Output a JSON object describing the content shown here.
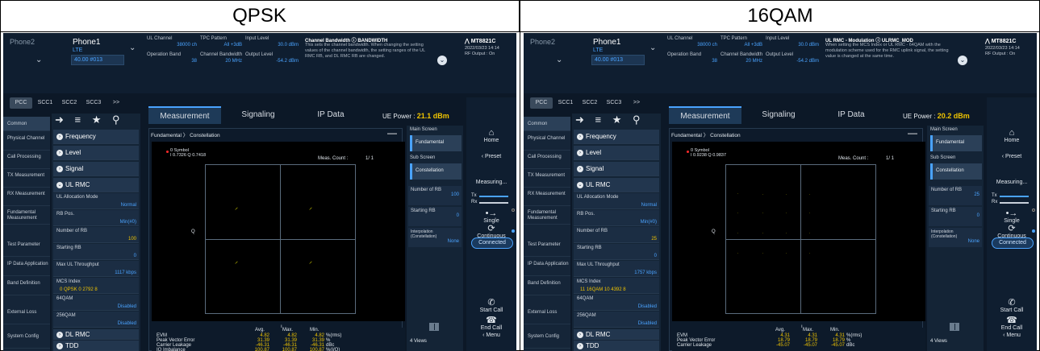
{
  "headers": {
    "left": "QPSK",
    "right": "16QAM"
  },
  "screens": [
    {
      "phone2": "Phone2",
      "phone1": "Phone1",
      "phone1_sub": "LTE",
      "phone1_box": "40.00 #013",
      "ul_channel_label": "UL Channel",
      "ul_channel_value": "38000 ch",
      "tpc_label": "TPC Pattern",
      "tpc_value": "All +3dB",
      "input_level_label": "Input Level",
      "input_level_value": "30.0 dBm",
      "op_band_label": "Operation Band",
      "op_band_value": "38",
      "ch_bw_label": "Channel Bandwidth",
      "ch_bw_value": "20 MHz",
      "output_level_label": "Output Level",
      "output_level_value": "-54.2 dBm",
      "info_title": "Channel Bandwidth ⓘ BANDWIDTH",
      "info_desc": "This sets the channel bandwidth. When changing the setting values of the channel bandwidth, the setting ranges of the UL RMC RB, and DL RMC RB are changed.",
      "model": "MT8821C",
      "datetime": "2022/03/23 14:14",
      "rf_output": "RF Output : On",
      "cc_tabs": [
        "PCC",
        "SCC1",
        "SCC2",
        "SCC3",
        ">>"
      ],
      "sidebar": [
        "Common",
        "Physical Channel",
        "Call Processing",
        "TX Measurement",
        "RX Measurement",
        "Fundamental Measurement",
        "Test Parameter",
        "IP Data Application",
        "Band Definition",
        "External Loss",
        "System Config"
      ],
      "params": {
        "frequency": "Frequency",
        "level": "Level",
        "signal": "Signal",
        "ulrmc": "UL RMC",
        "alloc_label": "UL Allocation Mode",
        "alloc_value": "Normal",
        "rbpos_label": "RB Pos.",
        "rbpos_value": "Min(#0)",
        "nrb_label": "Number of RB",
        "nrb_value": "100",
        "srb_label": "Starting RB",
        "srb_value": "0",
        "tput_label": "Max UL Throughput",
        "tput_value": "1117 kbps",
        "mcs_label": "MCS Index",
        "mcs_value": "0  QPSK  0  2792  8",
        "q64_label": "64QAM",
        "q64_value": "Disabled",
        "q256_label": "256QAM",
        "q256_value": "Disabled",
        "dlrmc": "DL RMC",
        "tdd": "TDD"
      },
      "main_tabs": [
        "Measurement",
        "Signaling",
        "IP Data"
      ],
      "ue_power_label": "UE Power :",
      "ue_power_value": "21.1 dBm",
      "breadcrumb": [
        "Fundamental",
        "Constellation"
      ],
      "symbol_line1": "0 Symbol",
      "symbol_line2": "I 0.7326 Q 0.7418",
      "meas_count_label": "Meas. Count :",
      "meas_count_value": "1/    1",
      "q_axis": "Q",
      "i_axis": "I",
      "result_headers": [
        "Avg.",
        "Max.",
        "Min."
      ],
      "results": [
        {
          "name": "EVM",
          "avg": "4.82",
          "max": "4.82",
          "min": "4.82",
          "unit": "%(rms)"
        },
        {
          "name": "Peak Vector Error",
          "avg": "31.39",
          "max": "31.39",
          "min": "31.39",
          "unit": "%"
        },
        {
          "name": "Carrier Leakage",
          "avg": "-46.31",
          "max": "-46.31",
          "min": "-46.31",
          "unit": "dBc"
        },
        {
          "name": "IQ Imbalance",
          "avg": "100.87",
          "max": "100.87",
          "min": "100.87",
          "unit": "%(I/Q)"
        }
      ],
      "main_screen_label": "Main Screen",
      "main_screen_value": "Fundamental",
      "sub_screen_label": "Sub Screen",
      "sub_screen_value": "Constellation",
      "panel_nrb_label": "Number of RB",
      "panel_nrb_value": "100",
      "panel_srb_label": "Starting RB",
      "panel_srb_value": "0",
      "interp_label": "Interpolation (Constellation)",
      "interp_value": "None",
      "views": "4 Views",
      "controls": {
        "home": "Home",
        "preset": "Preset",
        "measuring": "Measuring...",
        "tx": "Tx",
        "rx": "Rx",
        "single": "Single",
        "continuous": "Continuous",
        "connected": "Connected",
        "start_call": "Start Call",
        "end_call": "End Call",
        "menu": "Menu"
      }
    },
    {
      "phone2": "Phone2",
      "phone1": "Phone1",
      "phone1_sub": "LTE",
      "phone1_box": "40.00 #013",
      "ul_channel_label": "UL Channel",
      "ul_channel_value": "38000 ch",
      "tpc_label": "TPC Pattern",
      "tpc_value": "All +3dB",
      "input_level_label": "Input Level",
      "input_level_value": "30.0 dBm",
      "op_band_label": "Operation Band",
      "op_band_value": "38",
      "ch_bw_label": "Channel Bandwidth",
      "ch_bw_value": "20 MHz",
      "output_level_label": "Output Level",
      "output_level_value": "-54.2 dBm",
      "info_title": "UL RMC - Modulation ⓘ ULRMC_MOD",
      "info_desc": "When setting the MCS Index or UL RMC - 64QAM with the modulation scheme used for the RMC uplink signal, the setting value is changed at the same time.",
      "model": "MT8821C",
      "datetime": "2022/03/23 14:14",
      "rf_output": "RF Output : On",
      "cc_tabs": [
        "PCC",
        "SCC1",
        "SCC2",
        "SCC3",
        ">>"
      ],
      "sidebar": [
        "Common",
        "Physical Channel",
        "Call Processing",
        "TX Measurement",
        "RX Measurement",
        "Fundamental Measurement",
        "Test Parameter",
        "IP Data Application",
        "Band Definition",
        "External Loss",
        "System Config"
      ],
      "params": {
        "frequency": "Frequency",
        "level": "Level",
        "signal": "Signal",
        "ulrmc": "UL RMC",
        "alloc_label": "UL Allocation Mode",
        "alloc_value": "Normal",
        "rbpos_label": "RB Pos.",
        "rbpos_value": "Min(#0)",
        "nrb_label": "Number of RB",
        "nrb_value": "25",
        "srb_label": "Starting RB",
        "srb_value": "0",
        "tput_label": "Max UL Throughput",
        "tput_value": "1757 kbps",
        "mcs_label": "MCS Index",
        "mcs_value": "11  16QAM  10  4392  8",
        "q64_label": "64QAM",
        "q64_value": "Disabled",
        "q256_label": "256QAM",
        "q256_value": "Disabled",
        "dlrmc": "DL RMC",
        "tdd": "TDD"
      },
      "main_tabs": [
        "Measurement",
        "Signaling",
        "IP Data"
      ],
      "ue_power_label": "UE Power :",
      "ue_power_value": "20.2 dBm",
      "breadcrumb": [
        "Fundamental",
        "Constellation"
      ],
      "symbol_line1": "0 Symbol",
      "symbol_line2": "I 0.9238 Q 0.9837",
      "meas_count_label": "Meas. Count :",
      "meas_count_value": "1/    1",
      "q_axis": "Q",
      "i_axis": "I",
      "result_headers": [
        "Avg.",
        "Max.",
        "Min."
      ],
      "results": [
        {
          "name": "EVM",
          "avg": "4.31",
          "max": "4.31",
          "min": "4.31",
          "unit": "%(rms)"
        },
        {
          "name": "Peak Vector Error",
          "avg": "18.79",
          "max": "18.79",
          "min": "18.79",
          "unit": "%"
        },
        {
          "name": "Carrier Leakage",
          "avg": "-45.07",
          "max": "-45.07",
          "min": "-45.07",
          "unit": "dBc"
        }
      ],
      "main_screen_label": "Main Screen",
      "main_screen_value": "Fundamental",
      "sub_screen_label": "Sub Screen",
      "sub_screen_value": "Constellation",
      "panel_nrb_label": "Number of RB",
      "panel_nrb_value": "25",
      "panel_srb_label": "Starting RB",
      "panel_srb_value": "0",
      "interp_label": "Interpolation (Constellation)",
      "interp_value": "None",
      "views": "4 Views",
      "controls": {
        "home": "Home",
        "preset": "Preset",
        "measuring": "Measuring...",
        "tx": "Tx",
        "rx": "Rx",
        "single": "Single",
        "continuous": "Continuous",
        "connected": "Connected",
        "start_call": "Start Call",
        "end_call": "End Call",
        "menu": "Menu"
      }
    }
  ],
  "colors": {
    "accent": "#4aa3ff",
    "highlight": "#f0c400",
    "constellation": "#f4f000",
    "connected": "#1a3a5e"
  }
}
